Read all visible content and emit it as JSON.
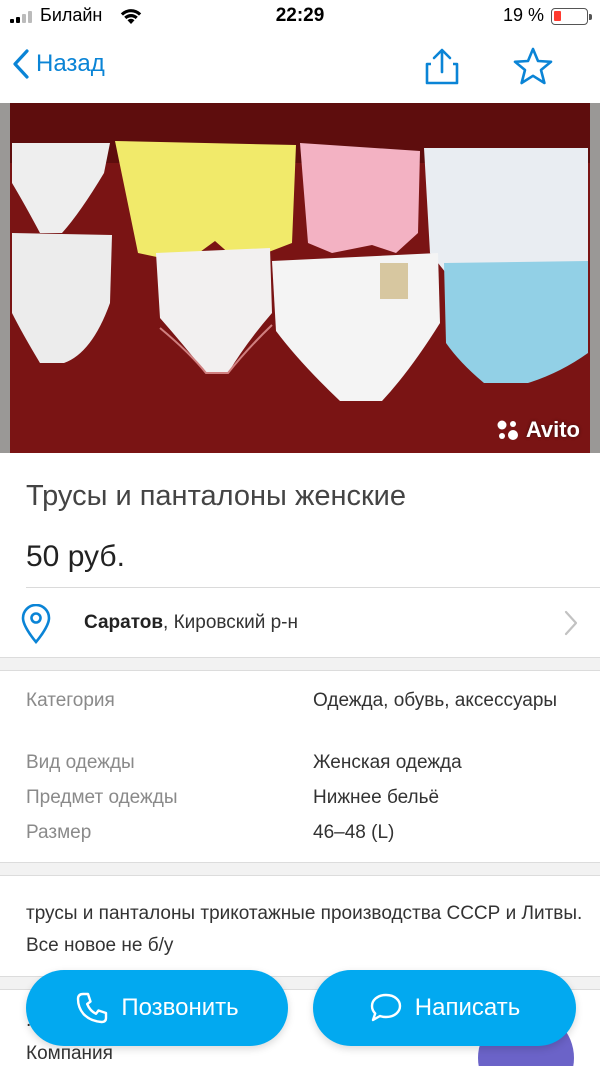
{
  "status": {
    "carrier": "Билайн",
    "time": "22:29",
    "battery": "19 %",
    "battery_level_percent": 19
  },
  "nav": {
    "back_label": "Назад",
    "icons": [
      "chevron-left-icon",
      "share-icon",
      "star-icon"
    ]
  },
  "photo": {
    "watermark": "Avito"
  },
  "listing": {
    "title": "Трусы и панталоны женские",
    "price": "50 руб."
  },
  "location": {
    "city": "Саратов",
    "district": ", Кировский р-н"
  },
  "params": [
    {
      "key": "Категория",
      "value": "Одежда, обувь, аксессуары"
    },
    {
      "key": "Вид одежды",
      "value": "Женская одежда"
    },
    {
      "key": "Предмет одежды",
      "value": "Нижнее бельё"
    },
    {
      "key": "Размер",
      "value": "46–48 (L)"
    }
  ],
  "description": "трусы и панталоны трикотажные производства СССР и Литвы. Все новое не б/у",
  "seller": {
    "name_partial": ".",
    "type": "Компания"
  },
  "actions": {
    "call_label": "Позвонить",
    "write_label": "Написать"
  },
  "colors": {
    "accent": "#0a84d6",
    "button": "#02a9f0",
    "battery_low": "#ff3b30"
  }
}
